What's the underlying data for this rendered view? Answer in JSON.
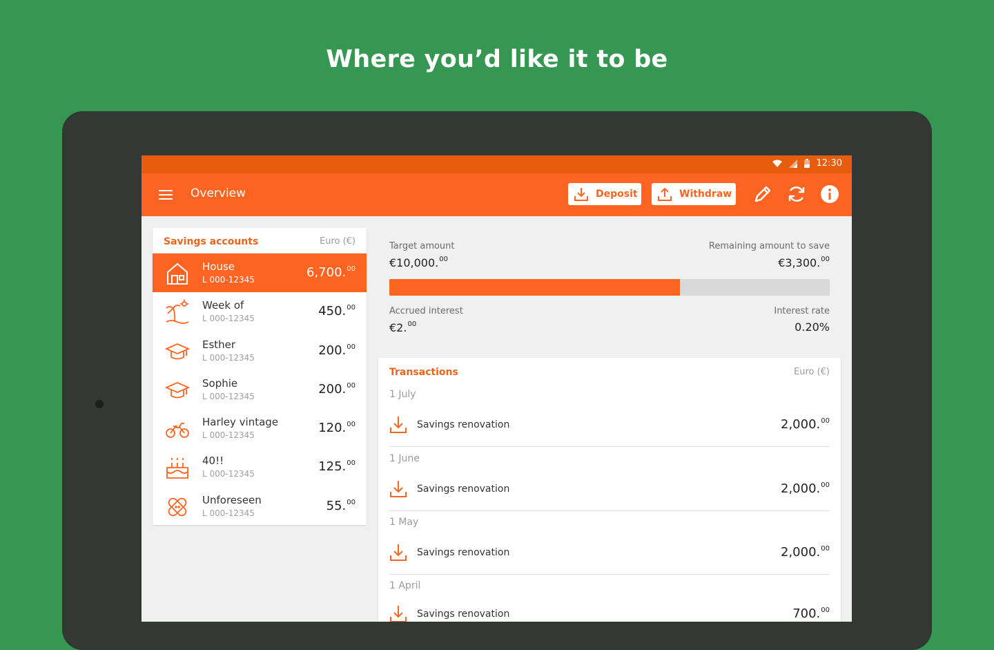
{
  "headline": "Where you’d like it to be",
  "status": {
    "time": "12:30"
  },
  "appbar": {
    "title": "Overview",
    "deposit_label": "Deposit",
    "withdraw_label": "Withdraw"
  },
  "accounts": {
    "title": "Savings accounts",
    "currency": "Euro (€)",
    "items": [
      {
        "name": "House",
        "number": "L 000-12345",
        "amount": "6,700.",
        "cents": "00",
        "icon": "house-icon",
        "active": true
      },
      {
        "name": "Week of",
        "number": "L 000-12345",
        "amount": "450.",
        "cents": "00",
        "icon": "beach-icon"
      },
      {
        "name": "Esther",
        "number": "L 000-12345",
        "amount": "200.",
        "cents": "00",
        "icon": "graduation-cap-icon"
      },
      {
        "name": "Sophie",
        "number": "L 000-12345",
        "amount": "200.",
        "cents": "00",
        "icon": "graduation-cap-icon"
      },
      {
        "name": "Harley vintage",
        "number": "L 000-12345",
        "amount": "120.",
        "cents": "00",
        "icon": "motorcycle-icon"
      },
      {
        "name": "40!!",
        "number": "L 000-12345",
        "amount": "125.",
        "cents": "00",
        "icon": "cake-icon"
      },
      {
        "name": "Unforeseen",
        "number": "L 000-12345",
        "amount": "55.",
        "cents": "00",
        "icon": "bandage-icon"
      }
    ]
  },
  "target": {
    "target_label": "Target amount",
    "target_value": "€10,000.",
    "target_cents": "00",
    "remaining_label": "Remaining amount to save",
    "remaining_value": "€3,300.",
    "remaining_cents": "00",
    "progress_fraction": 0.66,
    "interest_label": "Accrued interest",
    "interest_value": "€2.",
    "interest_cents": "00",
    "rate_label": "Interest rate",
    "rate_value": "0.20%"
  },
  "transactions": {
    "title": "Transactions",
    "currency": "Euro (€)",
    "groups": [
      {
        "date": "1 July",
        "desc": "Savings renovation",
        "amount": "2,000.",
        "cents": "00"
      },
      {
        "date": "1 June",
        "desc": "Savings renovation",
        "amount": "2,000.",
        "cents": "00"
      },
      {
        "date": "1 May",
        "desc": "Savings renovation",
        "amount": "2,000.",
        "cents": "00"
      },
      {
        "date": "1 April",
        "desc": "Savings renovation",
        "amount": "700.",
        "cents": "00"
      }
    ]
  },
  "colors": {
    "brand": "#fd6421",
    "background": "#359751"
  }
}
